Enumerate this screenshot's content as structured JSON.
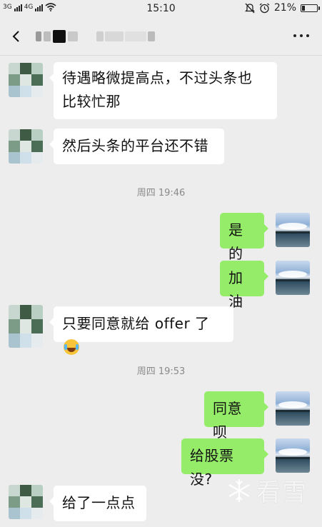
{
  "status_bar": {
    "network": "3G",
    "network2": "4G",
    "time": "15:10",
    "battery": "21%",
    "battery_level": 0.21
  },
  "nav": {
    "title_blur": ""
  },
  "messages": [
    {
      "side": "in",
      "text_line1": "待遇略微提高点，不过头条也",
      "text_line2": "比较忙那"
    },
    {
      "side": "in",
      "text": "然后头条的平台还不错"
    },
    {
      "type": "time",
      "text": "周四 19:46"
    },
    {
      "side": "out",
      "text": "是的"
    },
    {
      "side": "out",
      "text": "加油"
    },
    {
      "side": "in",
      "text": "只要同意就给 offer 了",
      "emoji": "tears-of-joy-emoji"
    },
    {
      "type": "time",
      "text": "周四 19:53"
    },
    {
      "side": "out",
      "text": "同意呗"
    },
    {
      "side": "out",
      "text": "给股票没?"
    },
    {
      "side": "in",
      "text": "给了一点点"
    }
  ],
  "watermark": "看雪",
  "colors": {
    "background": "#ededed",
    "bubble_out": "#95ec69",
    "bubble_in": "#ffffff"
  }
}
